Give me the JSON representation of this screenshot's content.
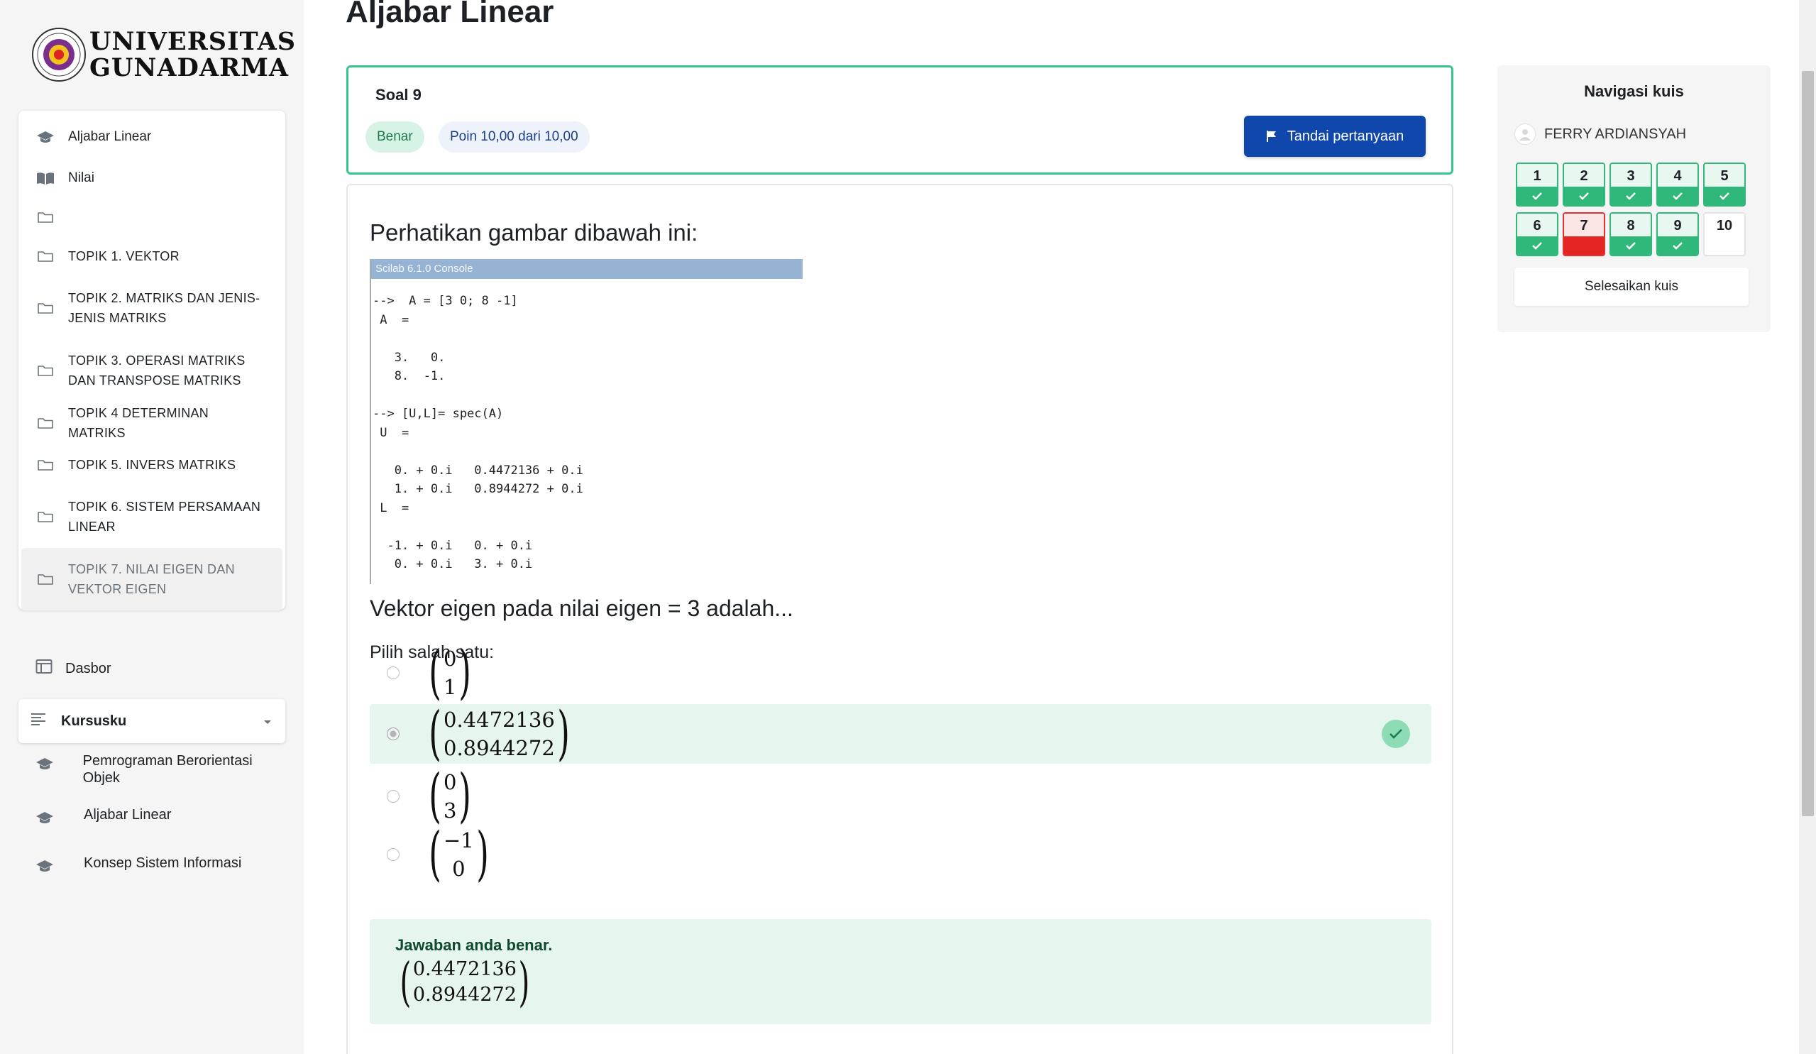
{
  "logo": {
    "line1": "UNIVERSITAS",
    "line2": "GUNADARMA"
  },
  "sidebar": {
    "items": [
      {
        "label": "Aljabar Linear",
        "icon": "graduation-cap-icon"
      },
      {
        "label": "Nilai",
        "icon": "book-icon"
      },
      {
        "label": "",
        "icon": "folder-icon"
      },
      {
        "label": "TOPIK 1. VEKTOR",
        "icon": "folder-icon"
      },
      {
        "label": "TOPIK 2. MATRIKS DAN JENIS-JENIS MATRIKS",
        "icon": "folder-icon"
      },
      {
        "label": "TOPIK 3. OPERASI MATRIKS DAN TRANSPOSE MATRIKS",
        "icon": "folder-icon"
      },
      {
        "label": "TOPIK 4 DETERMINAN MATRIKS",
        "icon": "folder-icon"
      },
      {
        "label": "TOPIK 5. INVERS MATRIKS",
        "icon": "folder-icon"
      },
      {
        "label": "TOPIK 6. SISTEM PERSAMAAN LINEAR",
        "icon": "folder-icon"
      },
      {
        "label": "TOPIK 7. NILAI EIGEN DAN VEKTOR EIGEN",
        "icon": "folder-icon",
        "active": true
      }
    ],
    "dashboard": "Dasbor",
    "my_courses": {
      "title": "Kursusku",
      "items": [
        "Pemrograman Berorientasi Objek",
        "Aljabar Linear",
        "Konsep Sistem Informasi"
      ]
    }
  },
  "page": {
    "title": "Aljabar Linear"
  },
  "question_info": {
    "number": "Soal 9",
    "status": "Benar",
    "points": "Poin 10,00 dari 10,00",
    "flag_label": "Tandai pertanyaan"
  },
  "question": {
    "text": "Perhatikan gambar dibawah ini:",
    "console_title": "Scilab 6.1.0 Console",
    "console_lines": [
      "-->  A = [3 0; 8 -1]",
      " A  =",
      "",
      "   3.   0.",
      "   8.  -1.",
      "",
      "--> [U,L]= spec(A)",
      " U  =",
      "",
      "   0. + 0.i   0.4472136 + 0.i",
      "   1. + 0.i   0.8944272 + 0.i",
      " L  =",
      "",
      "  -1. + 0.i   0. + 0.i",
      "   0. + 0.i   3. + 0.i"
    ],
    "sub_text": "Vektor eigen pada nilai eigen = 3 adalah...",
    "choose_label": "Pilih salah satu:",
    "options": [
      {
        "top": "0",
        "bottom": "1",
        "selected": false
      },
      {
        "top": "0.4472136",
        "bottom": "0.8944272",
        "selected": true,
        "correct": true
      },
      {
        "top": "0",
        "bottom": "3",
        "selected": false
      },
      {
        "top": "−1",
        "bottom": "0",
        "selected": false
      }
    ],
    "feedback": {
      "title": "Jawaban anda benar.",
      "top": "0.4472136",
      "bottom": "0.8944272"
    }
  },
  "quiz_nav": {
    "title": "Navigasi kuis",
    "user": "FERRY ARDIANSYAH",
    "buttons": [
      {
        "n": "1",
        "state": "correct"
      },
      {
        "n": "2",
        "state": "correct"
      },
      {
        "n": "3",
        "state": "correct"
      },
      {
        "n": "4",
        "state": "correct"
      },
      {
        "n": "5",
        "state": "correct"
      },
      {
        "n": "6",
        "state": "correct"
      },
      {
        "n": "7",
        "state": "incorrect"
      },
      {
        "n": "8",
        "state": "correct"
      },
      {
        "n": "9",
        "state": "correct"
      },
      {
        "n": "10",
        "state": "current"
      }
    ],
    "finish_label": "Selesaikan kuis"
  },
  "colors": {
    "correct_green": "#2fb879",
    "incorrect_red": "#e52424",
    "primary_blue": "#0f47ad",
    "correct_bg": "#e6f6ee"
  }
}
